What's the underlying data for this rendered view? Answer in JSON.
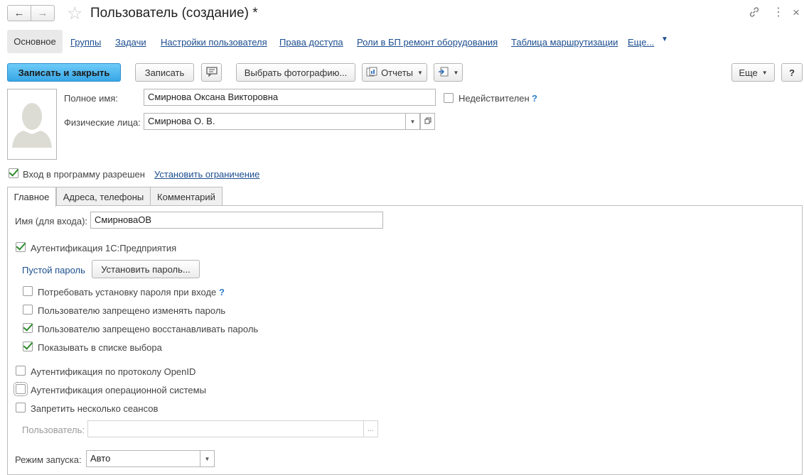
{
  "header": {
    "title": "Пользователь (создание) *",
    "back_icon": "←",
    "forward_icon": "→",
    "star_icon": "☆",
    "link_icon": "🔗",
    "more_icon": "⋮",
    "close_icon": "×"
  },
  "sections": {
    "active": "Основное",
    "links": [
      "Группы",
      "Задачи",
      "Настройки пользователя",
      "Права доступа",
      "Роли в БП ремонт оборудования",
      "Таблица маршрутизации",
      "Еще..."
    ]
  },
  "toolbar": {
    "save_close": "Записать и закрыть",
    "save": "Записать",
    "photo": "Выбрать фотографию...",
    "reports": "Отчеты",
    "more": "Еще",
    "help": "?"
  },
  "form": {
    "full_name_label": "Полное имя:",
    "full_name_value": "Смирнова Оксана Викторовна",
    "invalid_label": "Недействителен",
    "q": "?",
    "persons_label": "Физические лица:",
    "persons_value": "Смирнова О. В.",
    "login_allowed_label": "Вход в программу разрешен",
    "set_restriction": "Установить ограничение"
  },
  "tabs": [
    "Главное",
    "Адреса, телефоны",
    "Комментарий"
  ],
  "main": {
    "login_name_label": "Имя (для входа):",
    "login_name_value": "СмирноваОВ",
    "auth_1c_label": "Аутентификация 1С:Предприятия",
    "empty_password": "Пустой пароль",
    "set_password": "Установить пароль...",
    "require_password_label": "Потребовать установку пароля при входе",
    "deny_change_label": "Пользователю запрещено изменять пароль",
    "deny_restore_label": "Пользователю запрещено восстанавливать пароль",
    "show_in_list_label": "Показывать в списке выбора",
    "openid_label": "Аутентификация по протоколу OpenID",
    "os_auth_label": "Аутентификация операционной системы",
    "deny_sessions_label": "Запретить несколько сеансов",
    "user_label": "Пользователь:",
    "user_value": "",
    "user_btn": "...",
    "launch_mode_label": "Режим запуска:",
    "launch_mode_value": "Авто"
  },
  "colors": {
    "accent": "#38a7e6",
    "link": "#1d4e8f",
    "check": "#2e8b2e"
  }
}
